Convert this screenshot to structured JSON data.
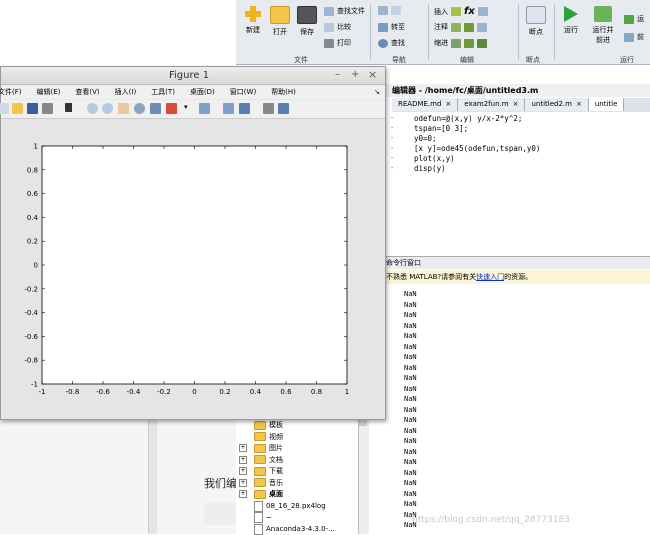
{
  "page": {
    "partial_text": "我们编",
    "bg_note_color": "#e4e4e4"
  },
  "toolstrip": {
    "file_buttons": [
      "新建",
      "打开",
      "保存"
    ],
    "file_small": [
      "查找文件",
      "比较",
      "打印"
    ],
    "nav_small": [
      "转至",
      "查找"
    ],
    "edit_small": [
      "插入",
      "注释",
      "缩进"
    ],
    "breakpoints": "断点",
    "run": "运行",
    "run_advance": [
      "运行并",
      "前进"
    ],
    "run_right": [
      "运",
      "前"
    ],
    "sections": [
      "文件",
      "导航",
      "编辑",
      "断点",
      "运行"
    ]
  },
  "editor": {
    "path_label": "编辑器 - /home/fc/桌面/untitled3.m",
    "tabs": [
      {
        "label": "README.md",
        "active": false
      },
      {
        "label": "exam2fun.m",
        "active": false
      },
      {
        "label": "untitled2.m",
        "active": false
      },
      {
        "label": "untitle",
        "active": true
      }
    ],
    "lines": [
      "odefun=@(x,y) y/x-2*y^2;",
      "tspan=[0 3];",
      "y0=0;",
      "[x y]=ode45(odefun,tspan,y0)",
      "plot(x,y)",
      "disp(y)"
    ]
  },
  "command_window": {
    "title": "命令行窗口",
    "info_prefix": "不熟悉 MATLAB?请参阅有关",
    "info_link": "快速入门",
    "info_suffix": "的资源。",
    "output_value": "NaN",
    "output_count": 23
  },
  "watermark": "https://blog.csdn.net/qq_28773183",
  "files": [
    {
      "name": "模板",
      "type": "folder",
      "expand": false
    },
    {
      "name": "视频",
      "type": "folder",
      "expand": false
    },
    {
      "name": "图片",
      "type": "folder",
      "expand": true
    },
    {
      "name": "文档",
      "type": "folder",
      "expand": true
    },
    {
      "name": "下载",
      "type": "folder",
      "expand": true
    },
    {
      "name": "音乐",
      "type": "folder",
      "expand": true
    },
    {
      "name": "桌面",
      "type": "folder",
      "expand": true,
      "bold": true
    },
    {
      "name": "08_16_28.px4log",
      "type": "file",
      "expand": false
    },
    {
      "name": "~",
      "type": "file",
      "expand": false
    },
    {
      "name": "Anaconda3-4.3.0-...",
      "type": "file",
      "expand": false
    }
  ],
  "figure": {
    "title": "Figure 1",
    "controls": [
      "–",
      "+",
      "×"
    ],
    "menus": [
      "文件(F)",
      "编辑(E)",
      "查看(V)",
      "插入(I)",
      "工具(T)",
      "桌面(D)",
      "窗口(W)",
      "帮助(H)"
    ],
    "menu_arrow": "↘"
  },
  "chart_data": {
    "type": "line",
    "title": "",
    "xlabel": "",
    "ylabel": "",
    "xlim": [
      -1,
      1
    ],
    "ylim": [
      -1,
      1
    ],
    "xticks": [
      -1,
      -0.8,
      -0.6,
      -0.4,
      -0.2,
      0,
      0.2,
      0.4,
      0.6,
      0.8,
      1
    ],
    "yticks": [
      -1,
      -0.8,
      -0.6,
      -0.4,
      -0.2,
      0,
      0.2,
      0.4,
      0.6,
      0.8,
      1
    ],
    "xtick_labels": [
      "-1",
      "-0.8",
      "-0.6",
      "-0.4",
      "-0.2",
      "0",
      "0.2",
      "0.4",
      "0.6",
      "0.8",
      "1"
    ],
    "ytick_labels": [
      "-1",
      "-0.8",
      "-0.6",
      "-0.4",
      "-0.2",
      "0",
      "0.2",
      "0.4",
      "0.6",
      "0.8",
      "1"
    ],
    "series": [],
    "grid": false
  },
  "colors": {
    "accent_green": "#2aa33a",
    "toolstrip_bg": "#e7ebf0",
    "link": "#0033cc",
    "info_bg": "#fbf4d6",
    "folder": "#f3c649"
  }
}
